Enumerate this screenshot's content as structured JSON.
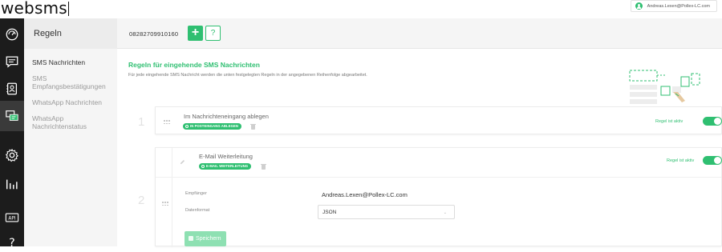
{
  "app": {
    "logo": "websms"
  },
  "user": {
    "email": "Andreas.Lexen@Pollex-LC.com"
  },
  "rail": {
    "items": [
      {
        "icon": "dashboard-icon",
        "active": false
      },
      {
        "icon": "chat-icon",
        "active": false
      },
      {
        "icon": "contacts-icon",
        "active": false
      },
      {
        "icon": "rules-icon",
        "active": true
      },
      {
        "icon": "settings-icon",
        "active": false
      },
      {
        "icon": "statistics-icon",
        "active": false
      },
      {
        "icon": "api-icon",
        "label": "API",
        "active": false
      },
      {
        "icon": "help-icon",
        "label": "?",
        "active": false
      }
    ]
  },
  "subnav": {
    "title": "Regeln",
    "items": [
      {
        "label": "SMS Nachrichten",
        "active": true
      },
      {
        "label": "SMS Empfangsbestätigungen",
        "active": false
      },
      {
        "label": "WhatsApp Nachrichten",
        "active": false
      },
      {
        "label": "WhatsApp Nachrichtenstatus",
        "active": false
      }
    ]
  },
  "header": {
    "number": "08282709910160",
    "add_label": "+",
    "help_label": "?"
  },
  "section": {
    "title": "Regeln für eingehende SMS Nachrichten",
    "description": "Für jede eingehende SMS Nachricht werden die unten festgelegten Regeln in der angegebenen Reihenfolge abgearbeitet."
  },
  "rules": [
    {
      "number": "1",
      "title": "Im Nachrichteneingang ablegen",
      "badge": "IN POSTEINGANG ABLEGEN",
      "status": "Regel ist aktiv",
      "active": true
    },
    {
      "number": "2",
      "title": "E-Mail Weiterleitung",
      "badge": "E-MAIL WEITERLEITUNG",
      "status": "Regel ist aktiv",
      "active": true,
      "fields": {
        "recipient_label": "Empfänger",
        "recipient_value": "Andreas.Lexen@Pollex-LC.com",
        "format_label": "Datenformat",
        "format_value": "JSON"
      },
      "save_label": "Speichern"
    }
  ],
  "colors": {
    "accent": "#2fbf71",
    "rail_bg": "#1c1c1c"
  }
}
